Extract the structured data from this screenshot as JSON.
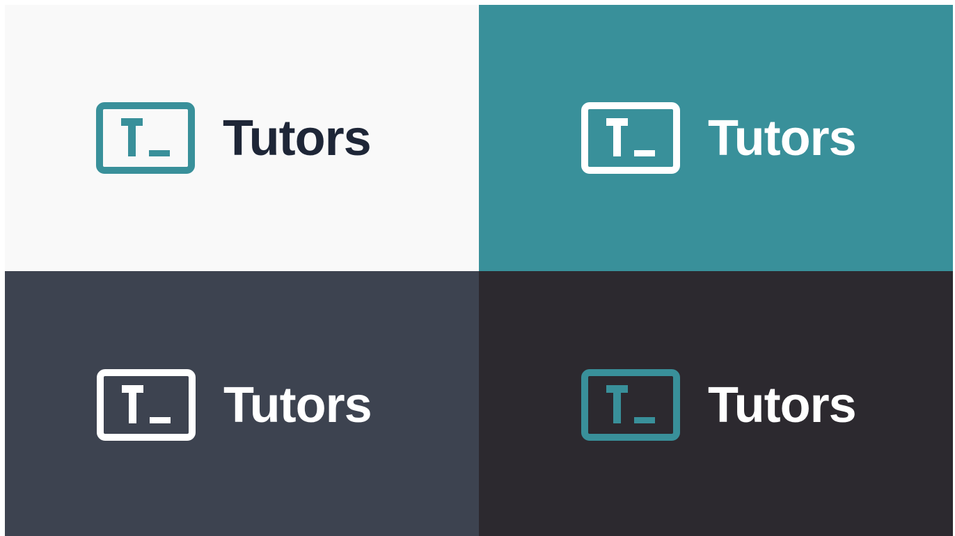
{
  "brand": {
    "name": "Tutors",
    "mark_letter": "T"
  },
  "colors": {
    "teal": "#39909A",
    "navy": "#1E2637",
    "white": "#FFFFFF",
    "light_bg": "#F9F9F9",
    "slate_bg": "#3D4350",
    "dark_bg": "#2C292F"
  },
  "variants": [
    {
      "id": "light",
      "background": "#F9F9F9",
      "mark_color": "#39909A",
      "text_color": "#1E2637"
    },
    {
      "id": "teal",
      "background": "#39909A",
      "mark_color": "#FFFFFF",
      "text_color": "#FFFFFF"
    },
    {
      "id": "slate",
      "background": "#3D4350",
      "mark_color": "#FFFFFF",
      "text_color": "#FFFFFF"
    },
    {
      "id": "dark",
      "background": "#2C292F",
      "mark_color": "#39909A",
      "text_color": "#FFFFFF"
    }
  ]
}
